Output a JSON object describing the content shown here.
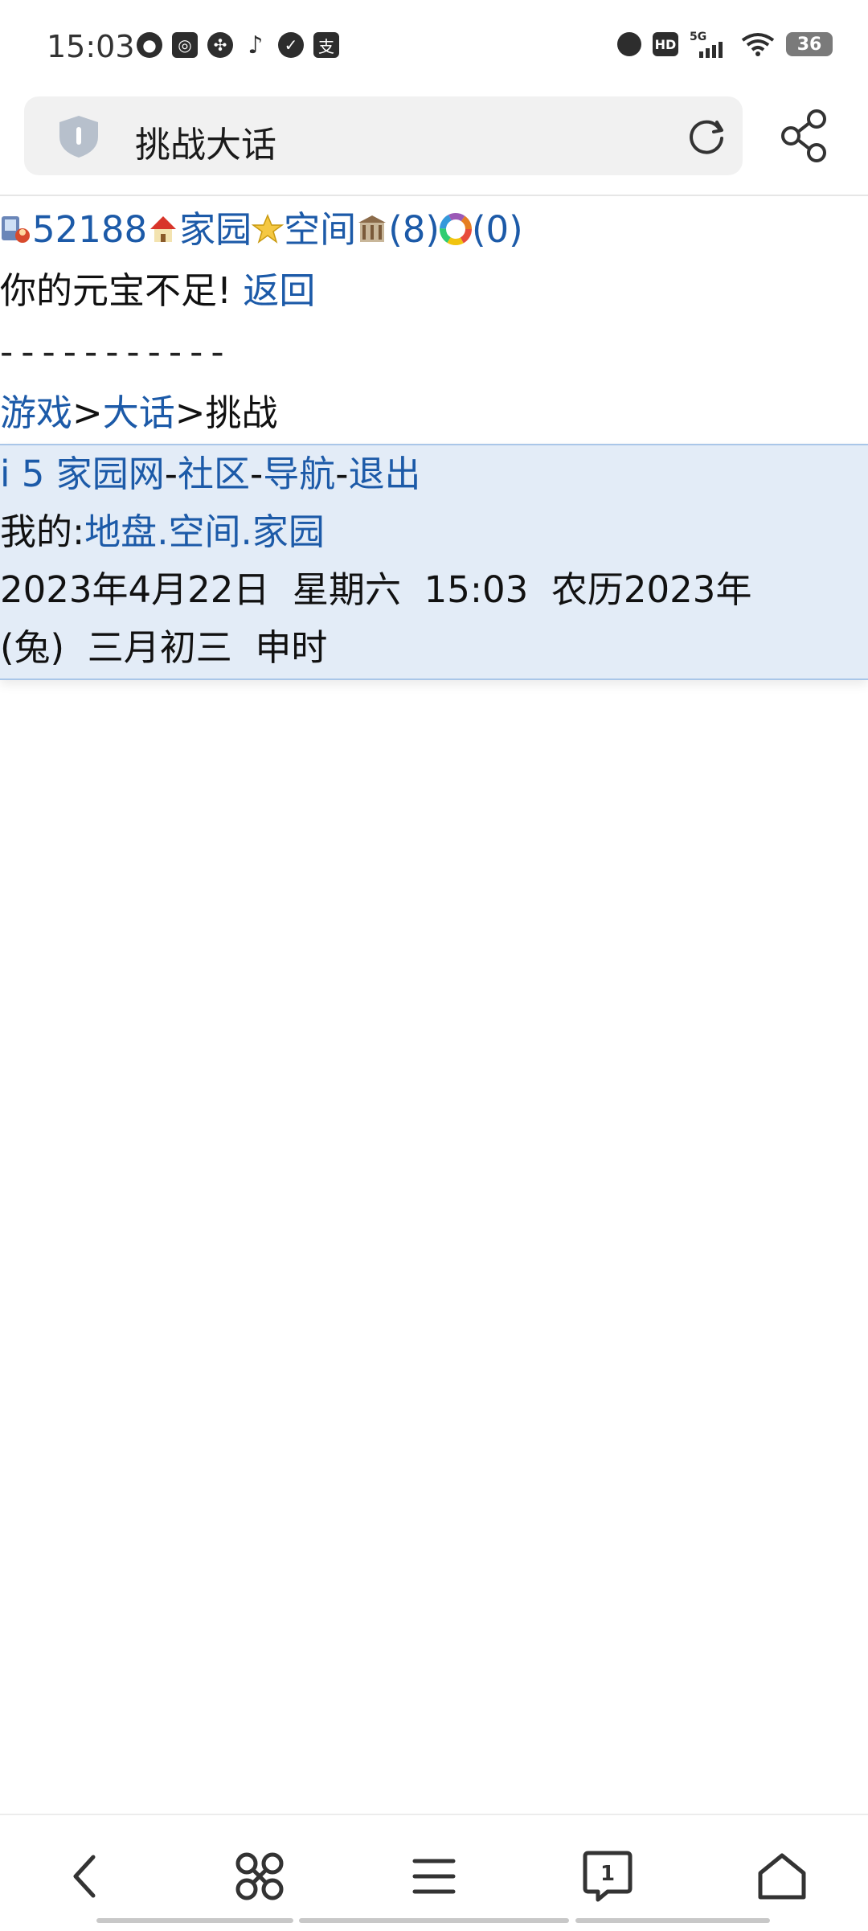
{
  "status_bar": {
    "time": "15:03",
    "left_icons": [
      "fire-icon",
      "app-icon",
      "fan-icon",
      "tiktok-icon",
      "shield-check-icon",
      "alipay-icon"
    ],
    "battery": "36",
    "network": "5G"
  },
  "browser": {
    "search_text": "挑战大话"
  },
  "content": {
    "id_number": "52188",
    "home_link": "家园",
    "space_link": "空间",
    "count_a": "(8)",
    "count_b": "(0)",
    "message": "你的元宝不足!",
    "back_link": "返回",
    "separator": "-----------",
    "breadcrumb": {
      "games": "游戏",
      "sep1": ">",
      "dahua": "大话",
      "sep2": ">",
      "current": "挑战"
    }
  },
  "footer": {
    "site_link": "i 5 家园网",
    "dash1": "-",
    "community_link": "社区",
    "dash2": "-",
    "nav_link": "导航",
    "dash3": "-",
    "logout_link": "退出",
    "mine_label": "我的:",
    "land_link": "地盘",
    "dot1": ".",
    "space_link": "空间",
    "dot2": ".",
    "home_link": "家园",
    "datetime_line1": "2023年4月22日  星期六  15:03  农历2023年",
    "datetime_line2": "(兔)  三月初三  申时"
  },
  "bottom_nav": {
    "tab_count": "1"
  }
}
